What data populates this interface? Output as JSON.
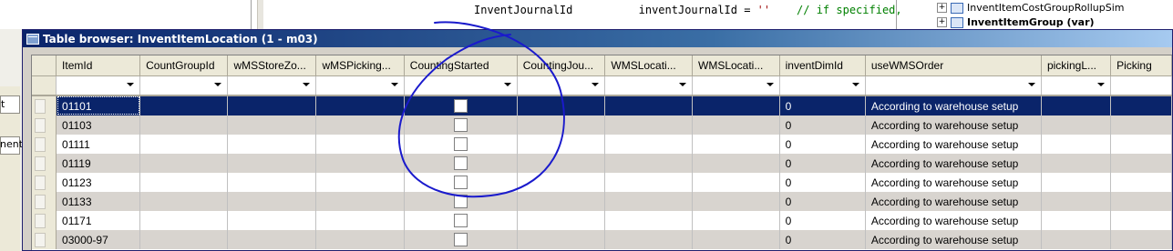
{
  "background": {
    "code_line": {
      "ident": "InventJournalId",
      "decl": "inventJournalId = ",
      "string": "''",
      "comment": "// if specified,"
    },
    "tree": [
      {
        "label": "InventItemCostGroupRollupSim",
        "bold": false
      },
      {
        "label": "InventItemGroup (var)",
        "bold": true
      }
    ],
    "left_labels": [
      "t",
      "nent"
    ]
  },
  "dialog": {
    "title": "Table browser: InventItemLocation (1 - m03)"
  },
  "grid": {
    "columns": [
      "ItemId",
      "CountGroupId",
      "wMSStoreZo...",
      "wMSPicking...",
      "CountingStarted",
      "CountingJou...",
      "WMSLocati...",
      "WMSLocati...",
      "inventDimId",
      "useWMSOrder",
      "pickingL...",
      "Picking"
    ],
    "rows": [
      {
        "itemId": "01101",
        "inventDimId": "0",
        "useWMSOrder": "According to warehouse setup",
        "active": true
      },
      {
        "itemId": "01103",
        "inventDimId": "0",
        "useWMSOrder": "According to warehouse setup",
        "active": false
      },
      {
        "itemId": "01111",
        "inventDimId": "0",
        "useWMSOrder": "According to warehouse setup",
        "active": false
      },
      {
        "itemId": "01119",
        "inventDimId": "0",
        "useWMSOrder": "According to warehouse setup",
        "active": false
      },
      {
        "itemId": "01123",
        "inventDimId": "0",
        "useWMSOrder": "According to warehouse setup",
        "active": false
      },
      {
        "itemId": "01133",
        "inventDimId": "0",
        "useWMSOrder": "According to warehouse setup",
        "active": false
      },
      {
        "itemId": "01171",
        "inventDimId": "0",
        "useWMSOrder": "According to warehouse setup",
        "active": false
      },
      {
        "itemId": "03000-97",
        "inventDimId": "0",
        "useWMSOrder": "According to warehouse setup",
        "active": false
      }
    ]
  },
  "colors": {
    "selection": "#0a246a",
    "annotation_ink": "#1a1acc",
    "alt_row": "#d8d4cf"
  }
}
